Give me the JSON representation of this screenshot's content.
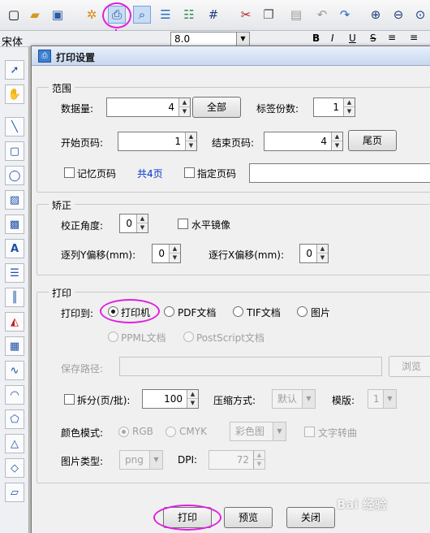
{
  "toolbar": {
    "icons": [
      "new-icon",
      "open-folder-icon",
      "save-icon",
      "settings-gear-icon",
      "print-icon",
      "print-preview-icon",
      "database-icon",
      "database-link-icon",
      "grid-icon",
      "cut-icon",
      "copy-icon",
      "paste-icon",
      "undo-icon",
      "redo-icon",
      "zoom-in-icon",
      "zoom-out-icon",
      "zoom-fit-icon"
    ]
  },
  "formatbar": {
    "font_name": "宋体",
    "font_size": "8.0",
    "bold": "B",
    "italic": "I",
    "underline": "U",
    "strike": "S"
  },
  "dialog": {
    "title": "打印设置",
    "range": {
      "legend": "范围",
      "data_count_label": "数据量:",
      "data_count_value": "4",
      "all_button": "全部",
      "copies_label": "标签份数:",
      "copies_value": "1",
      "start_page_label": "开始页码:",
      "start_page_value": "1",
      "end_page_label": "结束页码:",
      "end_page_value": "4",
      "last_page_button": "尾页",
      "remember_page_label": "记忆页码",
      "total_pages": "共4页",
      "specify_page_label": "指定页码"
    },
    "correction": {
      "legend": "矫正",
      "angle_label": "校正角度:",
      "angle_value": "0",
      "mirror_label": "水平镜像",
      "col_y_label": "逐列Y偏移(mm):",
      "col_y_value": "0",
      "row_x_label": "逐行X偏移(mm):",
      "row_x_value": "0"
    },
    "print": {
      "legend": "打印",
      "print_to_label": "打印到:",
      "targets": [
        "打印机",
        "PDF文档",
        "TIF文档",
        "图片"
      ],
      "targets2": [
        "PPML文档",
        "PostScript文档"
      ],
      "save_path_label": "保存路径:",
      "browse_button": "浏览",
      "split_label": "拆分(页/批):",
      "split_value": "100",
      "compression_label": "压缩方式:",
      "compression_value": "默认",
      "template_label": "模版:",
      "template_value": "1",
      "color_mode_label": "颜色模式:",
      "color_modes": [
        "RGB",
        "CMYK"
      ],
      "color_select_value": "彩色图",
      "text_convert_label": "文字转曲",
      "image_type_label": "图片类型:",
      "image_type_value": "png",
      "dpi_label": "DPI:",
      "dpi_value": "72"
    },
    "buttons": {
      "print": "打印",
      "preview": "预览",
      "close": "关闭"
    }
  },
  "watermark": "Bai 经验",
  "colors": {
    "annotation": "#e020e0",
    "link_blue": "#0033cc"
  }
}
